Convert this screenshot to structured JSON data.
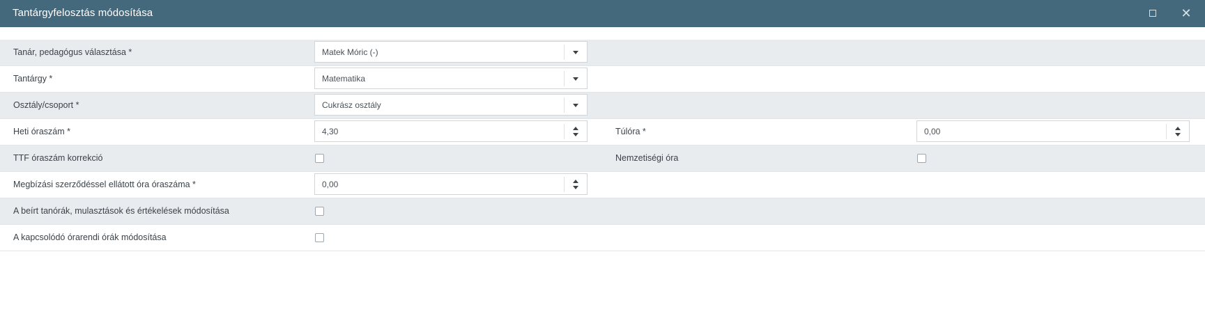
{
  "dialog": {
    "title": "Tantárgyfelosztás módosítása",
    "maximize_icon": "maximize-icon",
    "close_icon": "close-icon",
    "close_glyph": "✕"
  },
  "form": {
    "teacher": {
      "label": "Tanár, pedagógus választása *",
      "value": "Matek Móric (-)"
    },
    "subject": {
      "label": "Tantárgy *",
      "value": "Matematika"
    },
    "class_group": {
      "label": "Osztály/csoport *",
      "value": "Cukrász osztály"
    },
    "weekly_hours": {
      "label": "Heti óraszám *",
      "value": "4,30"
    },
    "overtime": {
      "label": "Túlóra *",
      "value": "0,00"
    },
    "ttf_correction": {
      "label": "TTF óraszám korrekció",
      "checked": false
    },
    "nationality_hour": {
      "label": "Nemzetiségi óra",
      "checked": false
    },
    "contract_hours": {
      "label": "Megbízási szerződéssel ellátott óra óraszáma *",
      "value": "0,00"
    },
    "modify_lessons": {
      "label": "A beírt tanórák, mulasztások és értékelések módosítása",
      "checked": false
    },
    "modify_timetable": {
      "label": "A kapcsolódó órarendi órák módosítása",
      "checked": false
    }
  },
  "colors": {
    "titlebar": "#44697d",
    "row_shaded": "#e9ecef",
    "row_white": "#ffffff"
  }
}
